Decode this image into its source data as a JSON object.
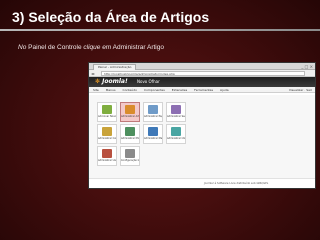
{
  "slide": {
    "title": "3) Seleção da Área de Artigos",
    "subtitle_parts": [
      "No",
      " Painel de Controle ",
      "clique em",
      " Administrar Artigo"
    ]
  },
  "browser": {
    "tab_title": "Painel - Administração",
    "url": "http://localhost/joomla/administrator/index.php",
    "window_controls": "_ □ ×"
  },
  "joomla": {
    "logo_text": "Joomla!",
    "site_name": "Novo Ofhar",
    "menu": [
      "Site",
      "Menus",
      "Conteúdo",
      "Componentes",
      "Extensões",
      "Ferramentas",
      "Ajuda"
    ],
    "menu_right": "Visualizar · Sair",
    "icons": [
      {
        "label": "Adicionar Novo Artigo",
        "color": "#7fae3f",
        "selected": false
      },
      {
        "label": "Administrar Artigos",
        "color": "#d98c2c",
        "selected": true
      },
      {
        "label": "Administrar Página Inicial",
        "color": "#6f9bc8",
        "selected": false
      },
      {
        "label": "Administrar Seções",
        "color": "#8d6fb3",
        "selected": false
      },
      {
        "label": "Administrar Categorias",
        "color": "#c9a33a",
        "selected": false
      },
      {
        "label": "Administrar Mídia",
        "color": "#4d8f5e",
        "selected": false
      },
      {
        "label": "Administrar Menus",
        "color": "#3f79b8",
        "selected": false
      },
      {
        "label": "Administrar Idiomas",
        "color": "#4aa6a3",
        "selected": false
      },
      {
        "label": "Administrar Usuários",
        "color": "#b8503f",
        "selected": false
      },
      {
        "label": "Configuração Global",
        "color": "#8a8a8a",
        "selected": false
      }
    ],
    "footer": "Joomla! é Software Livre distribuído sob GNU/GPL"
  }
}
